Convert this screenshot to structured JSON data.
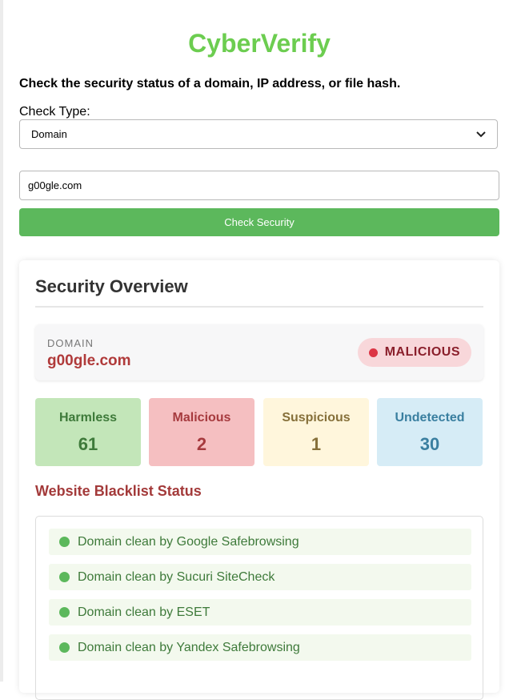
{
  "app": {
    "title": "CyberVerify",
    "subtitle": "Check the security status of a domain, IP address, or file hash."
  },
  "form": {
    "check_type_label": "Check Type:",
    "check_type_value": "Domain",
    "query_value": "g00gle.com",
    "submit_label": "Check Security"
  },
  "overview": {
    "title": "Security Overview",
    "kicker": "DOMAIN",
    "domain": "g00gle.com",
    "verdict": "MALICIOUS",
    "stats": [
      {
        "label": "Harmless",
        "value": "61"
      },
      {
        "label": "Malicious",
        "value": "2"
      },
      {
        "label": "Suspicious",
        "value": "1"
      },
      {
        "label": "Undetected",
        "value": "30"
      }
    ]
  },
  "blacklist": {
    "title": "Website Blacklist Status",
    "items": [
      "Domain clean by Google Safebrowsing",
      "Domain clean by Sucuri SiteCheck",
      "Domain clean by ESET",
      "Domain clean by Yandex Safebrowsing"
    ]
  },
  "icons": {
    "select_chevron": "chevron-down-icon",
    "verdict_dot": "status-dot-icon",
    "clean_dot": "check-dot-icon"
  },
  "colors": {
    "brand": "#6ccd50",
    "primary_button": "#5cb85c",
    "danger": "#dc3545",
    "domain_text": "#b03a3a"
  }
}
